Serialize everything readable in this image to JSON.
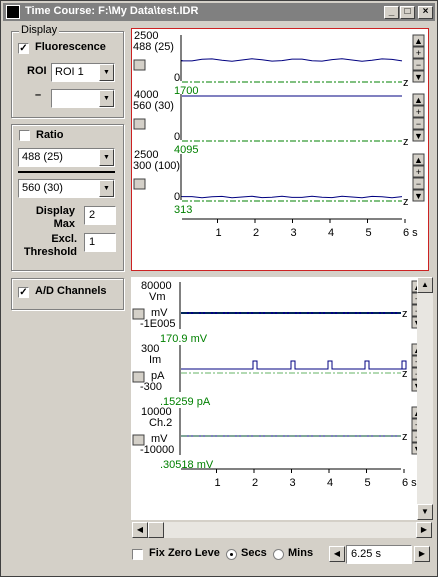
{
  "window": {
    "title": "Time Course: F:\\My Data\\test.IDR"
  },
  "display_group": {
    "label": "Display",
    "fluorescence_label": "Fluorescence",
    "fluorescence_checked": true,
    "roi_label": "ROI",
    "roi_value": "ROI 1",
    "minus_label": "–",
    "minus_value": ""
  },
  "ratio_group": {
    "ratio_label": "Ratio",
    "ratio_checked": false,
    "numerator": "488 (25)",
    "denominator": "560 (30)",
    "display_max_label": "Display Max",
    "display_max_value": "2",
    "excl_label": "Excl. Threshold",
    "excl_value": "1"
  },
  "ad_group": {
    "label": "A/D Channels",
    "checked": true
  },
  "fluor_traces": [
    {
      "name": "488 (25)",
      "ymax": "2500",
      "ymin": "0",
      "readout": "1700"
    },
    {
      "name": "560 (30)",
      "ymax": "4000",
      "ymin": "0",
      "readout": "4095"
    },
    {
      "name": "300 (100)",
      "ymax": "2500",
      "ymin": "0",
      "readout": "313"
    }
  ],
  "ad_traces": [
    {
      "name": "Vm",
      "ymax": "80000",
      "unit": "mV",
      "ymin": "-1E005",
      "readout": "170.9 mV"
    },
    {
      "name": "Im",
      "ymax": "300",
      "unit": "pA",
      "ymin": "-300",
      "readout": ".15259 pA"
    },
    {
      "name": "Ch.2",
      "ymax": "10000",
      "unit": "mV",
      "ymin": "-10000",
      "readout": ".30518 mV"
    }
  ],
  "time_axis": {
    "ticks": [
      "1",
      "2",
      "3",
      "4",
      "5",
      "6 s"
    ]
  },
  "zero_marker": "z",
  "bottom": {
    "fix_zero_label": "Fix Zero Leve",
    "fix_zero_checked": false,
    "secs_label": "Secs",
    "mins_label": "Mins",
    "units_selected": "Secs",
    "display_window": "6.25 s"
  },
  "colors": {
    "trace": "#000080",
    "zero_line": "#008000",
    "frame_highlight": "#cc2222"
  }
}
